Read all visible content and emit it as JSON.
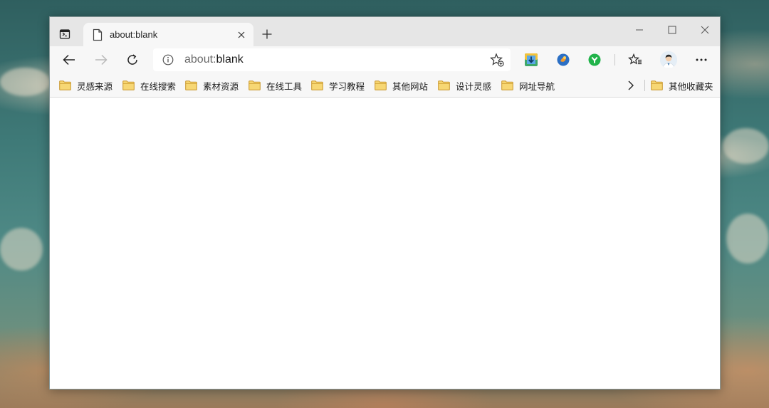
{
  "tab": {
    "title": "about:blank",
    "favicon": "page-icon"
  },
  "toolbar": {
    "url_scheme": "about:",
    "url_rest": "blank",
    "icons": [
      "back-arrow-icon",
      "forward-arrow-icon",
      "refresh-icon",
      "info-icon",
      "add-favorite-icon"
    ]
  },
  "extensions": [
    "download-extension-icon",
    "blue-globe-extension-icon",
    "green-check-extension-icon"
  ],
  "bookmarks": {
    "items": [
      {
        "label": "灵感来源"
      },
      {
        "label": "在线搜索"
      },
      {
        "label": "素材资源"
      },
      {
        "label": "在线工具"
      },
      {
        "label": "学习教程"
      },
      {
        "label": "其他网站"
      },
      {
        "label": "设计灵感"
      },
      {
        "label": "网址导航"
      }
    ],
    "other": "其他收藏夹"
  },
  "colors": {
    "folder_fill": "#f7d774",
    "folder_stroke": "#c9962a",
    "tabstrip": "#e6e6e6",
    "toolbar": "#f7f7f7"
  }
}
